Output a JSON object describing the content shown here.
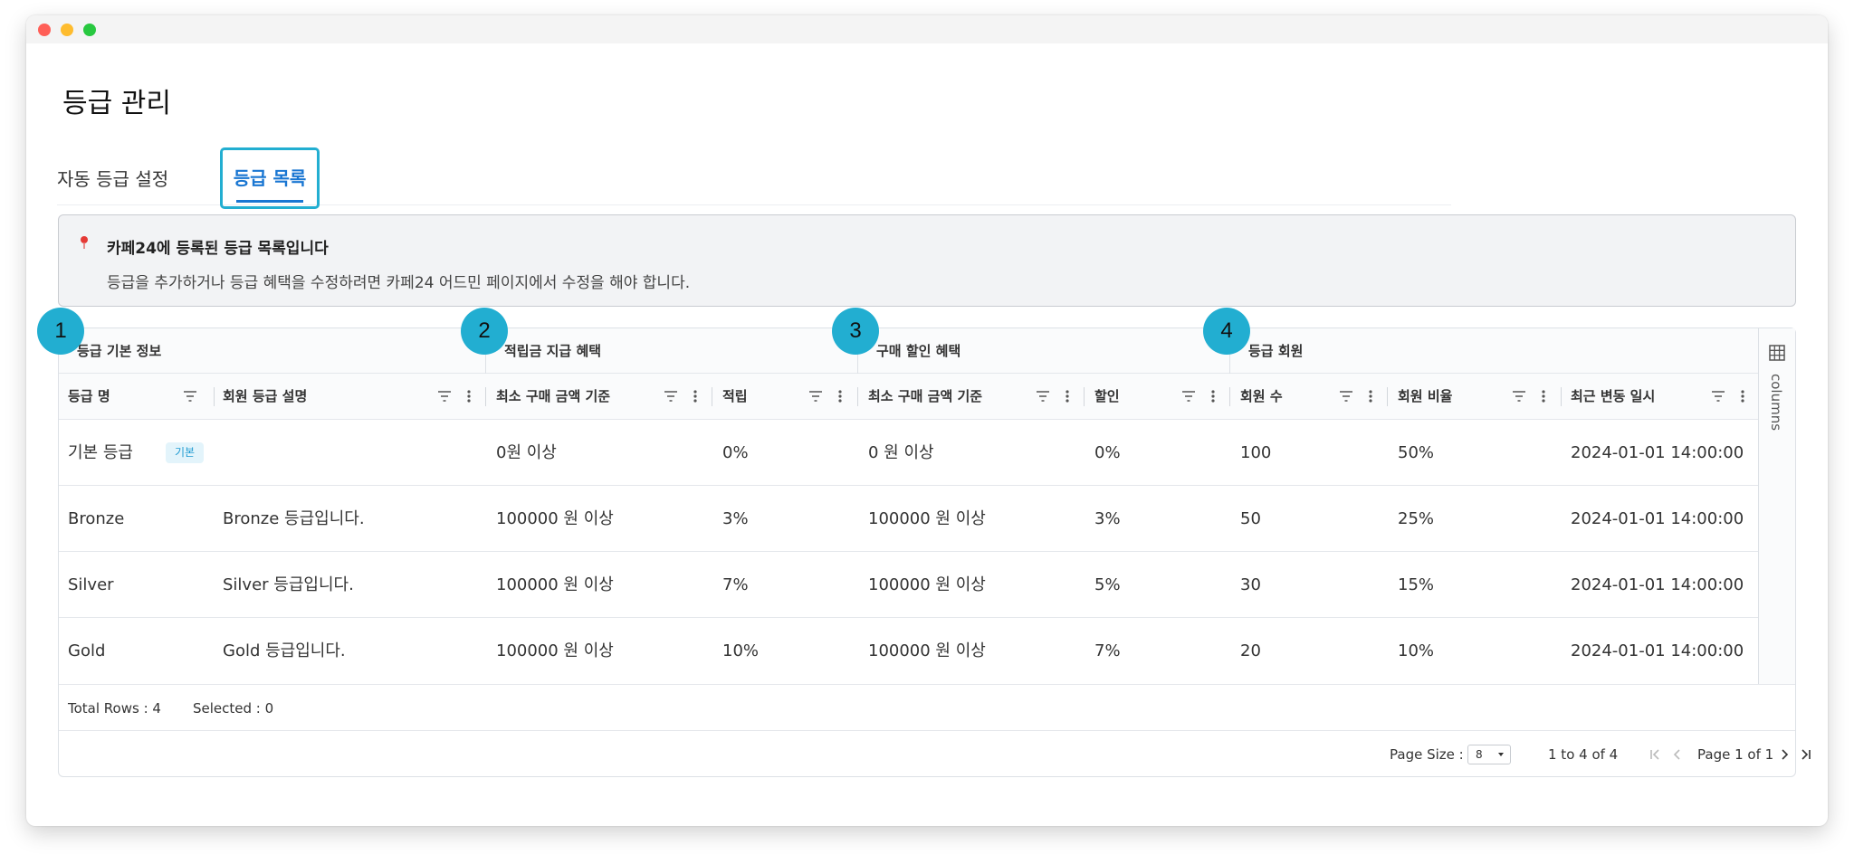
{
  "page": {
    "title": "등급 관리"
  },
  "tabs": [
    {
      "label": "자동 등급 설정",
      "active": false
    },
    {
      "label": "등급 목록",
      "active": true
    }
  ],
  "banner": {
    "title": "카페24에 등록된 등급 목록입니다",
    "description": "등급을 추가하거나 등급 혜택을 수정하려면 카페24 어드민 페이지에서 수정을 해야 합니다."
  },
  "markers": [
    "1",
    "2",
    "3",
    "4"
  ],
  "column_groups": [
    "등급 기본 정보",
    "적립금 지급 혜택",
    "구매 할인 혜택",
    "등급 회원"
  ],
  "columns": [
    "등급 명",
    "회원 등급 설명",
    "최소 구매 금액 기준",
    "적립",
    "최소 구매 금액 기준",
    "할인",
    "회원 수",
    "회원 비율",
    "최근 변동 일시"
  ],
  "rows": [
    {
      "name": "기본 등급",
      "badge": "기본",
      "desc": "",
      "point_min": "0원 이상",
      "point": "0%",
      "discount_min": "0 원 이상",
      "discount": "0%",
      "members": "100",
      "ratio": "50%",
      "updated": "2024-01-01 14:00:00"
    },
    {
      "name": "Bronze",
      "badge": "",
      "desc": "Bronze 등급입니다.",
      "point_min": "100000 원 이상",
      "point": "3%",
      "discount_min": "100000 원 이상",
      "discount": "3%",
      "members": "50",
      "ratio": "25%",
      "updated": "2024-01-01 14:00:00"
    },
    {
      "name": "Silver",
      "badge": "",
      "desc": "Silver 등급입니다.",
      "point_min": "100000 원 이상",
      "point": "7%",
      "discount_min": "100000 원 이상",
      "discount": "5%",
      "members": "30",
      "ratio": "15%",
      "updated": "2024-01-01 14:00:00"
    },
    {
      "name": "Gold",
      "badge": "",
      "desc": "Gold 등급입니다.",
      "point_min": "100000 원 이상",
      "point": "10%",
      "discount_min": "100000 원 이상",
      "discount": "7%",
      "members": "20",
      "ratio": "10%",
      "updated": "2024-01-01 14:00:00"
    }
  ],
  "side_panel": {
    "label": "columns"
  },
  "footer": {
    "total_rows": "Total Rows : 4",
    "selected": "Selected : 0",
    "page_size_label": "Page Size :",
    "page_size_value": "8",
    "range": "1 to 4 of 4",
    "page_info": "Page 1 of 1"
  },
  "colors": {
    "accent": "#22aed1",
    "tab_active": "#1976d2",
    "badge_text": "#1f9bd1",
    "badge_bg": "#e3f4fb"
  }
}
